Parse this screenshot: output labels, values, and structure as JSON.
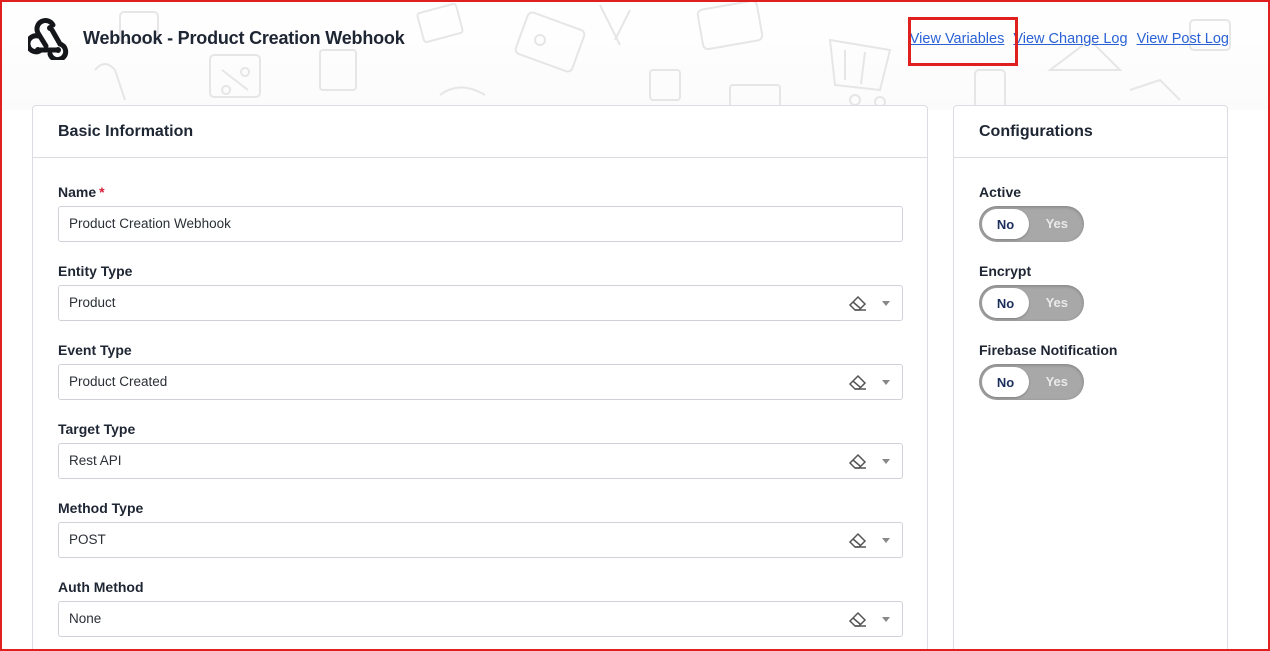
{
  "header": {
    "title": "Webhook - Product Creation Webhook",
    "links": {
      "view_variables": "View Variables",
      "view_change_log": "View Change Log",
      "view_post_log": "View Post Log"
    }
  },
  "basic": {
    "title": "Basic Information",
    "fields": {
      "name": {
        "label": "Name",
        "required_mark": "*",
        "value": "Product Creation Webhook"
      },
      "entity_type": {
        "label": "Entity Type",
        "value": "Product"
      },
      "event_type": {
        "label": "Event Type",
        "value": "Product Created"
      },
      "target_type": {
        "label": "Target Type",
        "value": "Rest API"
      },
      "method_type": {
        "label": "Method Type",
        "value": "POST"
      },
      "auth_method": {
        "label": "Auth Method",
        "value": "None"
      }
    }
  },
  "config": {
    "title": "Configurations",
    "toggles": {
      "active": {
        "label": "Active",
        "on_label": "No",
        "off_label": "Yes"
      },
      "encrypt": {
        "label": "Encrypt",
        "on_label": "No",
        "off_label": "Yes"
      },
      "firebase": {
        "label": "Firebase Notification",
        "on_label": "No",
        "off_label": "Yes"
      }
    }
  },
  "colors": {
    "accent_link": "#2a62d6",
    "highlight": "#e0201f",
    "toggle_track": "#a8a8a8",
    "toggle_text": "#1b2e5c"
  }
}
